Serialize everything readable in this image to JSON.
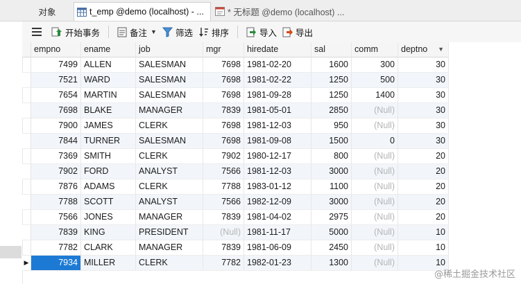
{
  "tabs": {
    "objects": "对象",
    "table": "t_emp @demo (localhost) - ...",
    "query": "* 无标题 @demo (localhost) ..."
  },
  "toolbar": {
    "begin_transaction": "开始事务",
    "memo": "备注",
    "filter": "筛选",
    "sort": "排序",
    "import": "导入",
    "export": "导出"
  },
  "columns": [
    "empno",
    "ename",
    "job",
    "mgr",
    "hiredate",
    "sal",
    "comm",
    "deptno"
  ],
  "rows": [
    [
      "7499",
      "ALLEN",
      "SALESMAN",
      "7698",
      "1981-02-20",
      "1600",
      "300",
      "30"
    ],
    [
      "7521",
      "WARD",
      "SALESMAN",
      "7698",
      "1981-02-22",
      "1250",
      "500",
      "30"
    ],
    [
      "7654",
      "MARTIN",
      "SALESMAN",
      "7698",
      "1981-09-28",
      "1250",
      "1400",
      "30"
    ],
    [
      "7698",
      "BLAKE",
      "MANAGER",
      "7839",
      "1981-05-01",
      "2850",
      "(Null)",
      "30"
    ],
    [
      "7900",
      "JAMES",
      "CLERK",
      "7698",
      "1981-12-03",
      "950",
      "(Null)",
      "30"
    ],
    [
      "7844",
      "TURNER",
      "SALESMAN",
      "7698",
      "1981-09-08",
      "1500",
      "0",
      "30"
    ],
    [
      "7369",
      "SMITH",
      "CLERK",
      "7902",
      "1980-12-17",
      "800",
      "(Null)",
      "20"
    ],
    [
      "7902",
      "FORD",
      "ANALYST",
      "7566",
      "1981-12-03",
      "3000",
      "(Null)",
      "20"
    ],
    [
      "7876",
      "ADAMS",
      "CLERK",
      "7788",
      "1983-01-12",
      "1100",
      "(Null)",
      "20"
    ],
    [
      "7788",
      "SCOTT",
      "ANALYST",
      "7566",
      "1982-12-09",
      "3000",
      "(Null)",
      "20"
    ],
    [
      "7566",
      "JONES",
      "MANAGER",
      "7839",
      "1981-04-02",
      "2975",
      "(Null)",
      "20"
    ],
    [
      "7839",
      "KING",
      "PRESIDENT",
      "(Null)",
      "1981-11-17",
      "5000",
      "(Null)",
      "10"
    ],
    [
      "7782",
      "CLARK",
      "MANAGER",
      "7839",
      "1981-06-09",
      "2450",
      "(Null)",
      "10"
    ],
    [
      "7934",
      "MILLER",
      "CLERK",
      "7782",
      "1982-01-23",
      "1300",
      "(Null)",
      "10"
    ]
  ],
  "selected_row": 13,
  "watermark": "@稀土掘金技术社区",
  "colors": {
    "selection": "#1c7ad4",
    "null_text": "#b4b4b4",
    "alt_row": "#f2f6fb"
  }
}
